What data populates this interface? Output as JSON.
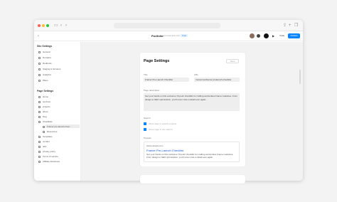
{
  "browser": {
    "back_icon": "chevron-left-icon",
    "forward_icon": "chevron-right-icon",
    "share_icon": "share-icon",
    "new_tab_icon": "plus-icon",
    "tabs_icon": "tabs-icon",
    "dot_colors": [
      "#ff5f57",
      "#febc2e",
      "#28c840"
    ]
  },
  "appbar": {
    "title": "Portfolio",
    "subtitle": "www.example.com",
    "badge": "Free",
    "invite_label": "Invite",
    "publish_label": "Publish",
    "play_icon": "play-icon"
  },
  "sidebar": {
    "site_settings_heading": "Site Settings",
    "site_items": [
      {
        "label": "General",
        "icon": "gear-icon"
      },
      {
        "label": "Domains",
        "icon": "globe-icon"
      },
      {
        "label": "Redirects",
        "icon": "redirect-icon"
      },
      {
        "label": "Staging & Versions",
        "icon": "layers-icon"
      },
      {
        "label": "Analytics",
        "icon": "chart-icon"
      },
      {
        "label": "Plans",
        "icon": "card-icon"
      }
    ],
    "page_settings_heading": "Page Settings",
    "page_items": [
      {
        "label": "Home",
        "icon": "page-icon"
      },
      {
        "label": "services",
        "icon": "page-icon"
      },
      {
        "label": "projects",
        "icon": "page-icon"
      },
      {
        "label": "about",
        "icon": "page-icon"
      },
      {
        "label": "blog",
        "icon": "page-icon"
      },
      {
        "label": "Checklists",
        "icon": "folder-icon"
      },
      {
        "label": "Framer pre-launch-chec...",
        "icon": "page-icon"
      },
      {
        "label": "Resources",
        "icon": "folder-icon"
      },
      {
        "label": "Templates",
        "icon": "folder-icon"
      },
      {
        "label": "contact",
        "icon": "page-icon"
      },
      {
        "label": "404",
        "icon": "page-icon"
      },
      {
        "label": "privacy policy",
        "icon": "page-icon"
      },
      {
        "label": "Terms of service",
        "icon": "page-icon"
      },
      {
        "label": "Affiliate disclosure",
        "icon": "page-icon"
      }
    ]
  },
  "page": {
    "title": "Page Settings",
    "save_label": "Save",
    "title_label": "Title",
    "title_value": "Framer Pre-Launch Checklist",
    "url_label": "URL",
    "url_value": "/resources/framer-prelaunch-checklist",
    "description_label": "Page description",
    "description_value": "Get your hands on this exclusive 72-point checklist for crafting world-class Framer websites. From design to SEO optimization, you'll never miss a detail ever again.",
    "search_label": "Search",
    "search_opt1": "Allow page to search engines",
    "search_opt2": "Show page in site search",
    "preview_label": "Preview",
    "preview_url": "www.example.com",
    "preview_title": "Framer Pre-Launch Checklist",
    "preview_desc": "Get your hands on this exclusive 72-point checklist for crafting world-class Framer websites. From design to SEO optimization, you'll never miss a detail ever again."
  },
  "colors": {
    "accent": "#0a84ff",
    "link": "#1a56db"
  }
}
